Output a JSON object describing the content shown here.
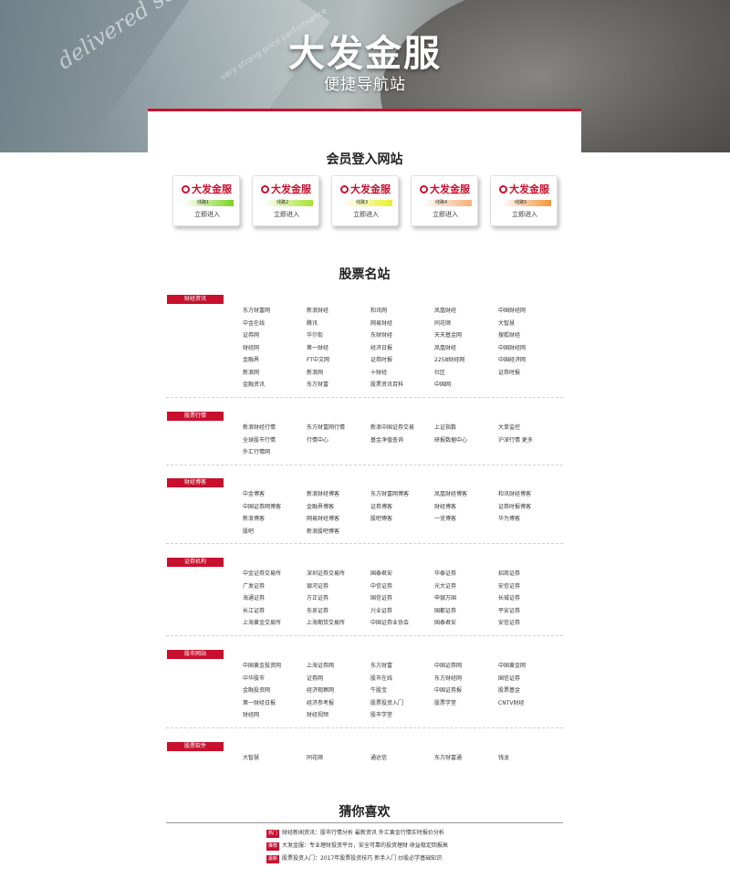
{
  "hero": {
    "title": "大发金服",
    "subtitle": "便捷导航站",
    "slogan": "delivered solid results in a challenging",
    "subslogan": "very strong price performance"
  },
  "colors": {
    "accent": "#c8102e"
  },
  "login": {
    "title": "会员登入网站",
    "cards": [
      {
        "logo": "大发金服",
        "line": "线路1",
        "enter": "立即进入",
        "bar_color": "#7ed321"
      },
      {
        "logo": "大发金服",
        "line": "线路2",
        "enter": "立即进入",
        "bar_color": "#a6e22e"
      },
      {
        "logo": "大发金服",
        "line": "线路3",
        "enter": "立即进入",
        "bar_color": "#e8f02a"
      },
      {
        "logo": "大发金服",
        "line": "线路4",
        "enter": "立即进入",
        "bar_color": "#f6b07a"
      },
      {
        "logo": "大发金服",
        "line": "线路5",
        "enter": "立即进入",
        "bar_color": "#f39436"
      }
    ]
  },
  "stock": {
    "title": "股票名站",
    "categories": [
      {
        "name": "财经资讯",
        "links": [
          "东方财富网",
          "新浪财经",
          "和讯网",
          "凤凰财经",
          "中国财经网",
          "中金在线",
          "腾讯",
          "网易财经",
          "同花顺",
          "大智慧",
          "证券网",
          "华尔街",
          "东财财经",
          "天天基金网",
          "搜狐财经",
          "财经网",
          "第一财经",
          "经济日报",
          "凤凰财经",
          "中国财经网",
          "金融界",
          "FT中文网",
          "证券时报",
          "2258财经网",
          "中国经济网",
          "新浪网",
          "新浪网",
          "十财经",
          "社区",
          "证券时报",
          "金融资讯",
          "东方财富",
          "股票资讯百科",
          "中国网"
        ]
      },
      {
        "name": "股票行情",
        "links": [
          "新浪财经行情",
          "东方财富网行情",
          "新浪中国证券交易",
          "上证指数",
          "大单监控",
          "全球股市行情",
          "行情中心",
          "基金净值查询",
          "研报数据中心",
          "沪深行情 更多",
          "外汇行情网"
        ]
      },
      {
        "name": "财经博客",
        "links": [
          "中金博客",
          "新浪财经博客",
          "东方财富网博客",
          "凤凰财经博客",
          "和讯财经博客",
          "中国证券网博客",
          "金融界博客",
          "证券博客",
          "财经博客",
          "证券时报博客",
          "新浪博客",
          "网易财经博客",
          "股吧博客",
          "一览博客",
          "华为博客",
          "股吧",
          "新浪股吧博客"
        ]
      },
      {
        "name": "证券机构",
        "links": [
          "中金证券交易所",
          "深圳证券交易所",
          "国泰君安",
          "华泰证券",
          "招商证券",
          "广发证券",
          "银河证券",
          "中信证券",
          "光大证券",
          "安信证券",
          "海通证券",
          "方正证券",
          "国信证券",
          "申银万国",
          "长城证券",
          "长江证券",
          "东吴证券",
          "兴业证券",
          "国都证券",
          "平安证券",
          "上海黄金交易所",
          "上海期货交易所",
          "中国证券业协会",
          "国泰君安",
          "安信证券"
        ]
      },
      {
        "name": "股市网站",
        "links": [
          "中国黄金投资网",
          "上海证券网",
          "东方财富",
          "中国证券网",
          "中国黄金网",
          "中华股市",
          "证券网",
          "股市在线",
          "东方财经网",
          "国信证券",
          "金融投资网",
          "经济观察网",
          "牛股宝",
          "中国证券报",
          "股票基金",
          "第一财经日报",
          "经济参考报",
          "股票投资入门",
          "股票学堂",
          "CNTV财经",
          "财经网",
          "财经视频",
          "股市学堂"
        ]
      },
      {
        "name": "股票软件",
        "links": [
          "大智慧",
          "同花顺",
          "通达信",
          "东方财富通",
          "钱龙"
        ]
      }
    ]
  },
  "guess": {
    "title": "猜你喜欢",
    "items": [
      {
        "tag": "热门",
        "text": "财经新闻资讯：股市行情分析 最新资讯 外汇黄金行情实时报价分析"
      },
      {
        "tag": "推荐",
        "text": "大发金服：专业理财投资平台，安全可靠的投资理财 收益稳定回报高"
      },
      {
        "tag": "最新",
        "text": "股票投资入门：2017年股票投资技巧 新手入门 炒股必学基础知识"
      }
    ]
  }
}
